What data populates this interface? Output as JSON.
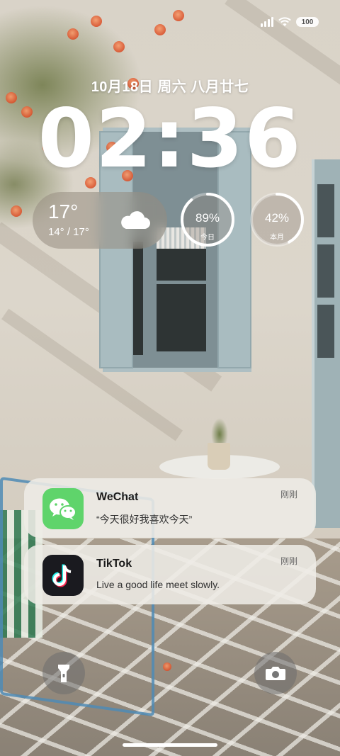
{
  "status_bar": {
    "signal_icon": "cellular-signal-icon",
    "wifi_icon": "wifi-icon",
    "battery_icon": "battery-icon",
    "battery_level": "100"
  },
  "lock_screen": {
    "date": "10月18日 周六 八月廿七",
    "time": "02:36"
  },
  "weather": {
    "current_temp": "17°",
    "range": "14° / 17°",
    "icon": "cloud-icon"
  },
  "rings": [
    {
      "value": "89%",
      "label": "今日",
      "fraction": 0.89
    },
    {
      "value": "42%",
      "label": "本月",
      "fraction": 0.42
    }
  ],
  "notifications": [
    {
      "app": "WeChat",
      "icon": "wechat-icon",
      "body": "“今天很好我喜欢今天”",
      "time": "刚刚",
      "icon_color": "#5fd46b"
    },
    {
      "app": "TikTok",
      "icon": "tiktok-icon",
      "body": "Live a good life meet slowly.",
      "time": "刚刚",
      "icon_color": "#1a1a1f"
    }
  ],
  "controls": {
    "left_icon": "flashlight-icon",
    "right_icon": "camera-icon"
  }
}
